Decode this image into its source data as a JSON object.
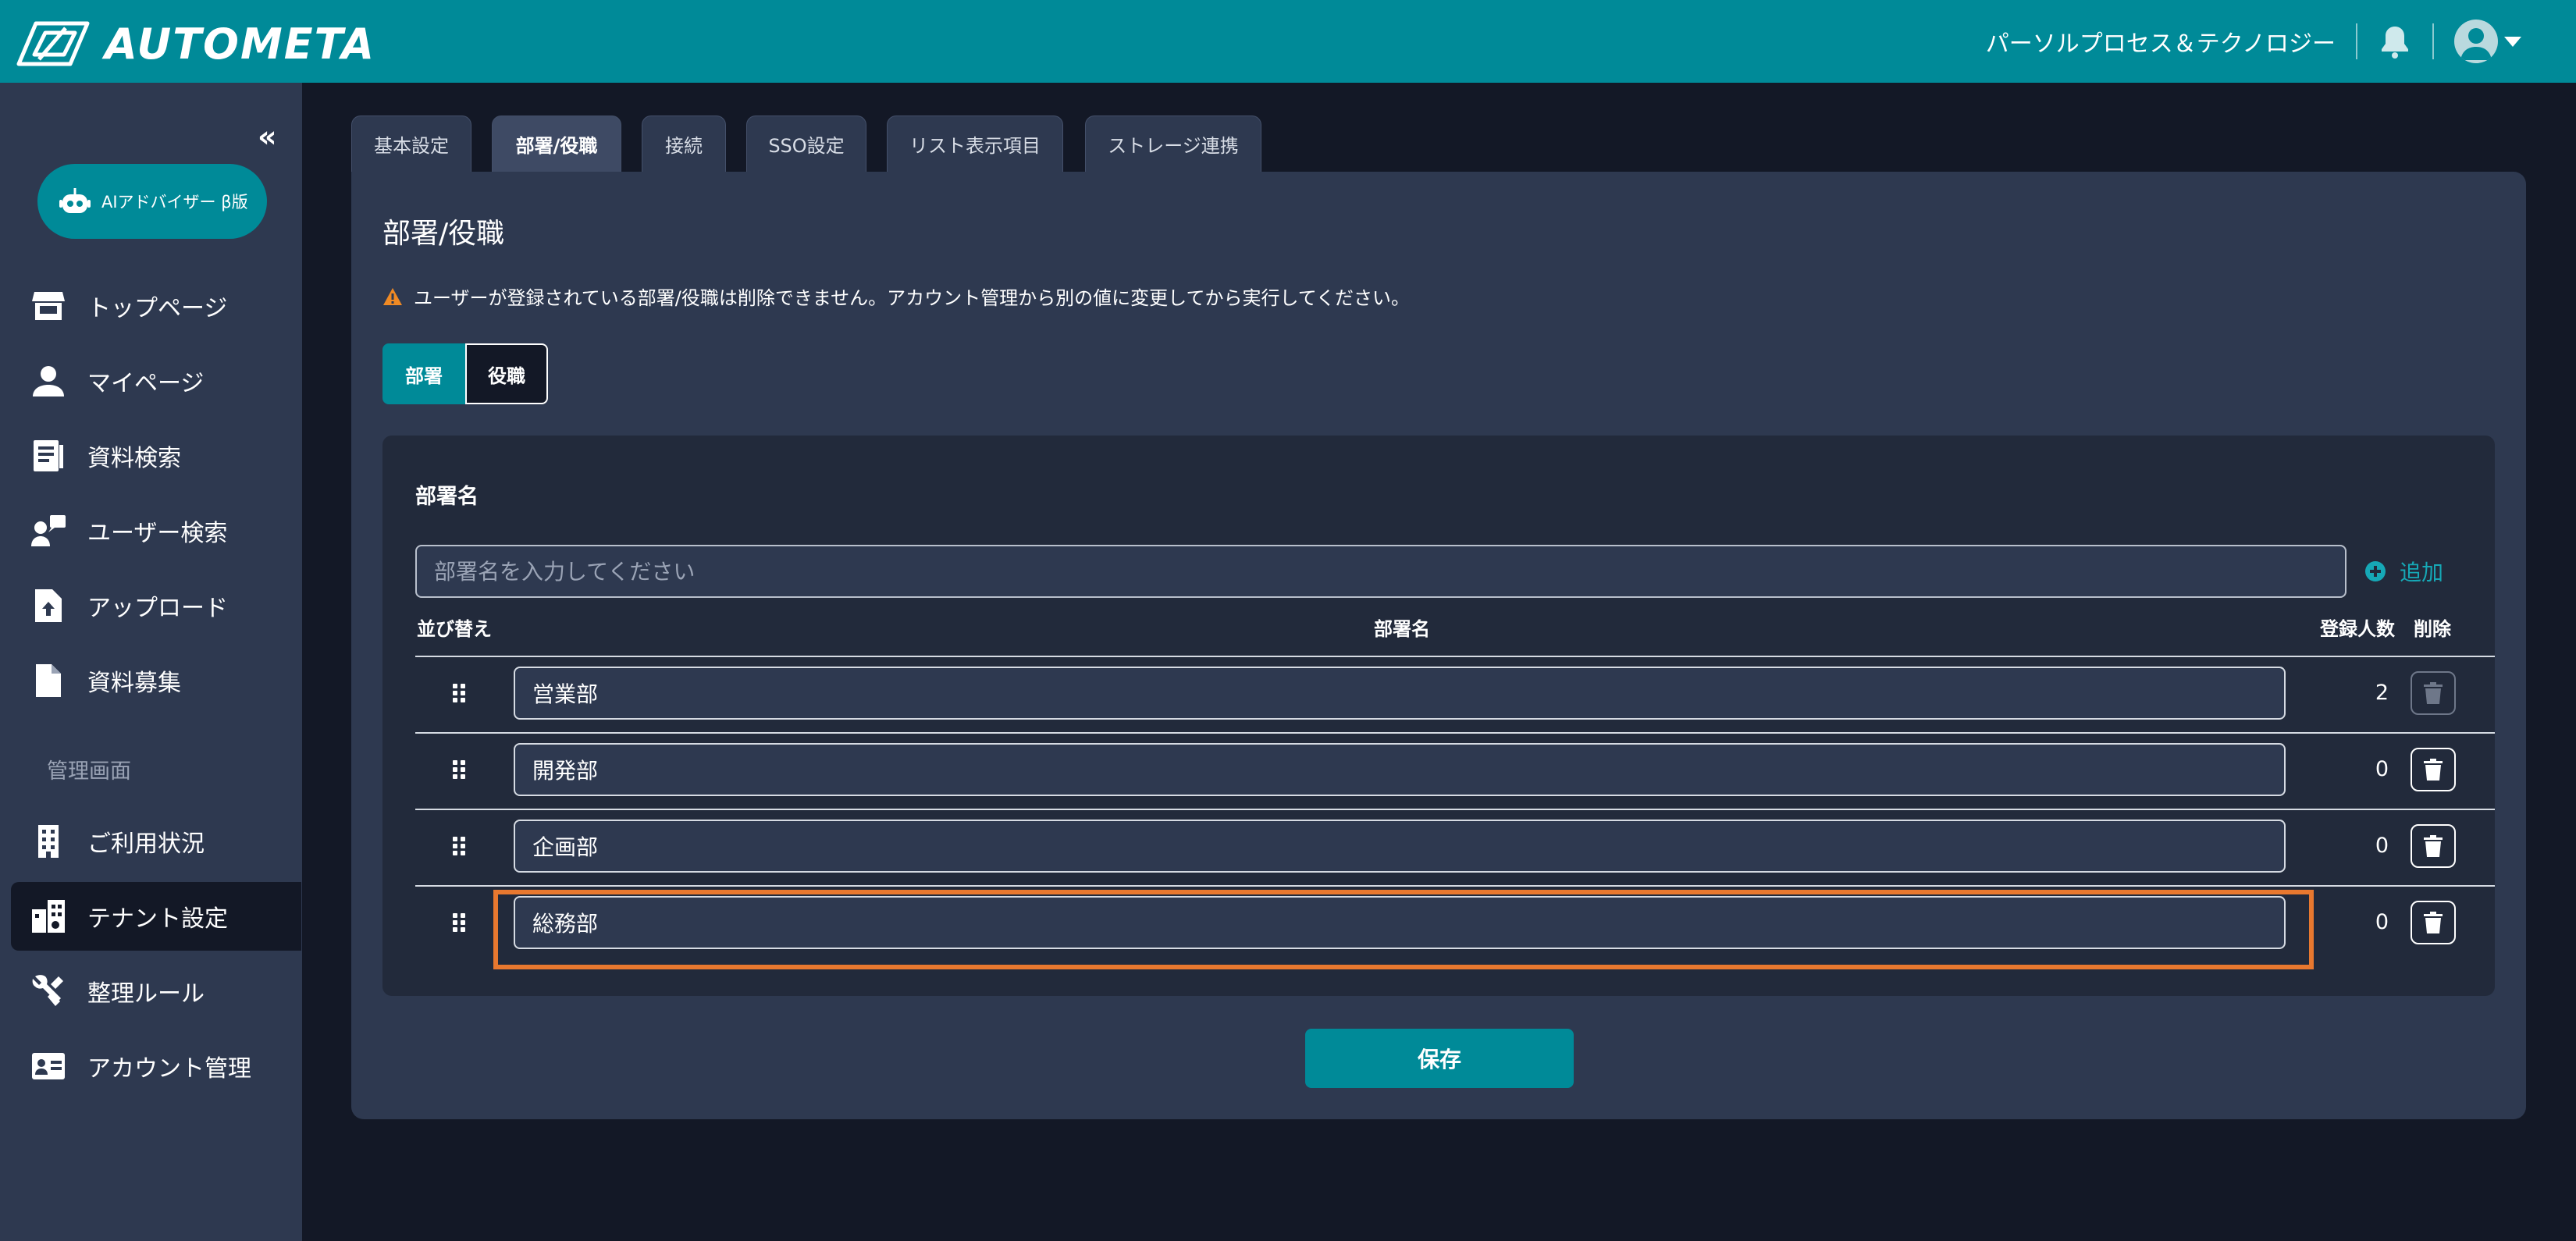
{
  "header": {
    "brand": "AUTOMETA",
    "company": "パーソルプロセス＆テクノロジー",
    "colors": {
      "bar": "#008a98",
      "accent": "#16a8b6",
      "highlight": "#e8782f"
    },
    "icons": [
      "logo-mark",
      "bell-icon",
      "avatar-icon",
      "caret-down-icon"
    ]
  },
  "sidebar": {
    "collapse_label": "«",
    "ai_button": "AIアドバイザー β版",
    "items": [
      {
        "label": "トップページ",
        "icon": "store-icon"
      },
      {
        "label": "マイページ",
        "icon": "person-icon"
      },
      {
        "label": "資料検索",
        "icon": "document-search-icon"
      },
      {
        "label": "ユーザー検索",
        "icon": "user-search-icon"
      },
      {
        "label": "アップロード",
        "icon": "upload-icon"
      },
      {
        "label": "資料募集",
        "icon": "file-icon"
      }
    ],
    "section_label": "管理画面",
    "admin_items": [
      {
        "label": "ご利用状況",
        "icon": "building-icon"
      },
      {
        "label": "テナント設定",
        "icon": "tenant-icon",
        "active": true
      },
      {
        "label": "整理ルール",
        "icon": "tools-icon"
      },
      {
        "label": "アカウント管理",
        "icon": "id-card-icon"
      }
    ]
  },
  "tabs": [
    {
      "label": "基本設定"
    },
    {
      "label": "部署/役職",
      "active": true
    },
    {
      "label": "接続"
    },
    {
      "label": "SSO設定"
    },
    {
      "label": "リスト表示項目"
    },
    {
      "label": "ストレージ連携"
    }
  ],
  "main": {
    "title": "部署/役職",
    "warning": "ユーザーが登録されている部署/役職は削除できません。アカウント管理から別の値に変更してから実行してください。",
    "segment": {
      "department": "部署",
      "position": "役職",
      "selected": "部署"
    },
    "section_label": "部署名",
    "input": {
      "placeholder": "部署名を入力してください",
      "value": ""
    },
    "add_label": "追加",
    "columns": {
      "sort": "並び替え",
      "name": "部署名",
      "count": "登録人数",
      "delete": "削除"
    },
    "rows": [
      {
        "name": "営業部",
        "count": "2",
        "deletable": false
      },
      {
        "name": "開発部",
        "count": "0",
        "deletable": true
      },
      {
        "name": "企画部",
        "count": "0",
        "deletable": true
      },
      {
        "name": "総務部",
        "count": "0",
        "deletable": true,
        "highlighted": true
      }
    ],
    "save_label": "保存"
  }
}
